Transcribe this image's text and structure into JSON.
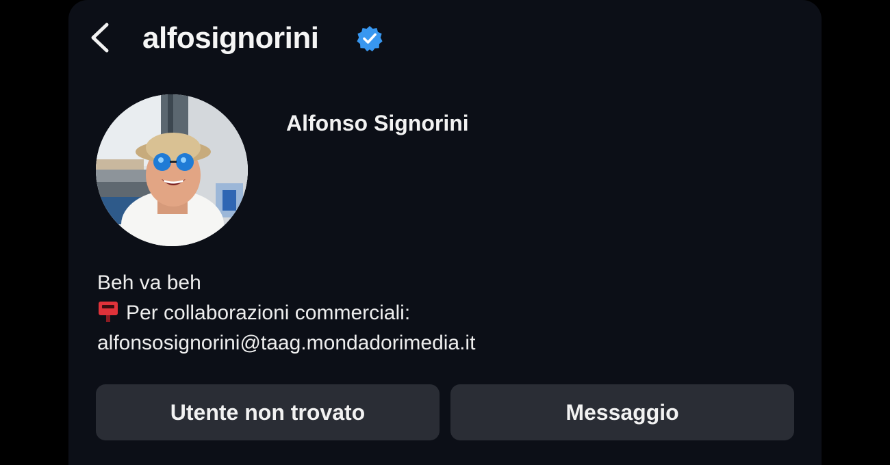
{
  "header": {
    "back_icon": "chevron-left-icon",
    "username": "alfosignorini",
    "verified_icon": "verified-badge-icon",
    "verified_color": "#3897f0"
  },
  "profile": {
    "avatar_icon": "profile-photo",
    "full_name": "Alfonso Signorini"
  },
  "bio": {
    "line1": "Beh va beh",
    "line2_icon": "postbox-emoji-icon",
    "line2": "Per collaborazioni commerciali:",
    "line3": "alfonsosignorini@taag.mondadorimedia.it"
  },
  "actions": {
    "primary_label": "Utente non trovato",
    "secondary_label": "Messaggio"
  }
}
